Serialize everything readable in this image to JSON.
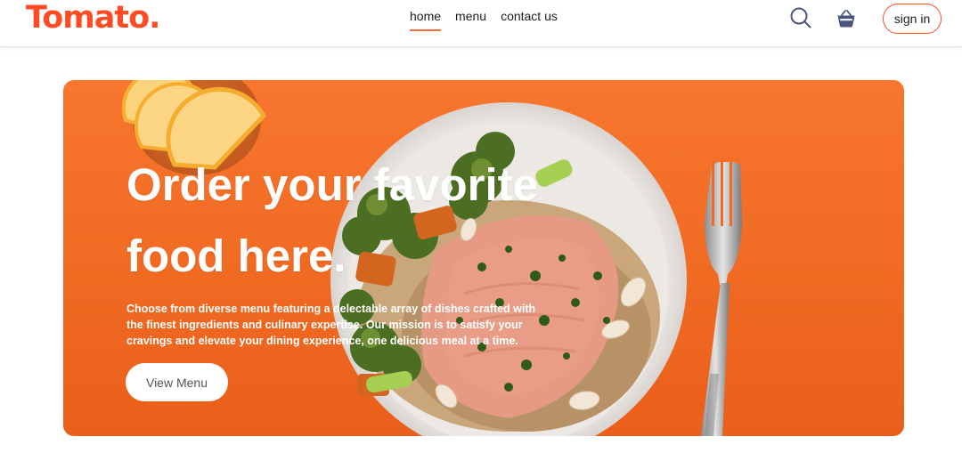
{
  "navbar": {
    "logo": "Tomato.",
    "menu": [
      {
        "label": "home",
        "active": true
      },
      {
        "label": "menu",
        "active": false
      },
      {
        "label": "contact us",
        "active": false
      }
    ],
    "search_icon": "search-icon",
    "basket_icon": "basket-icon",
    "signin_label": "sign in"
  },
  "hero": {
    "title": "Order your favorite food here.",
    "description": "Choose from diverse menu featuring a delectable array of dishes crafted with the finest ingredients and culinary expertise. Our mission is to satisfy your cravings and elevate your dining experience, one delicious meal at a time.",
    "button_label": "View Menu"
  },
  "colors": {
    "brand": "#ff4c24",
    "hero_bg": "#f06a22",
    "nav_text": "#1d1d1f",
    "icon": "#49557e"
  }
}
